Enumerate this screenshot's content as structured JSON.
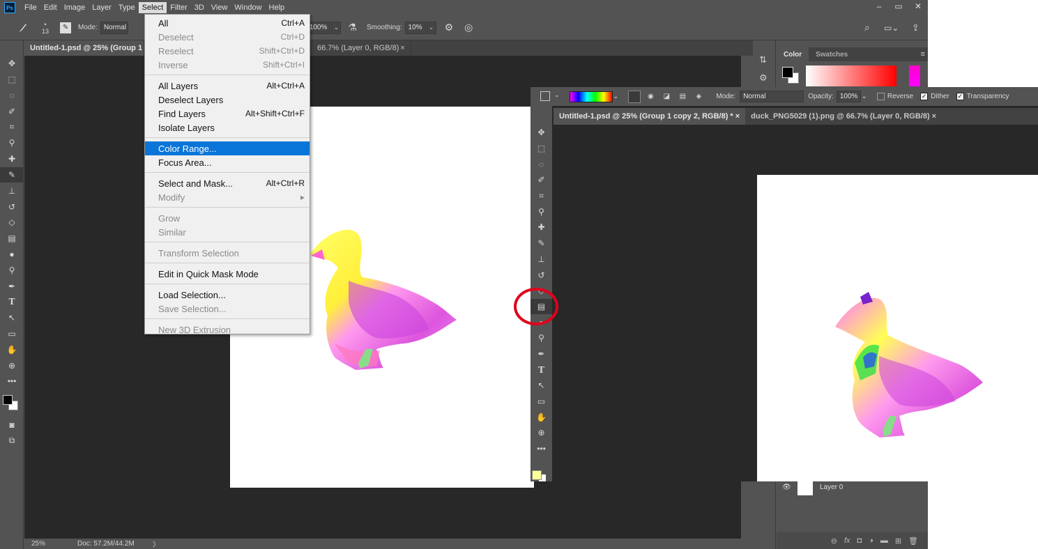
{
  "app": {
    "logo": "Ps"
  },
  "menubar": [
    "File",
    "Edit",
    "Image",
    "Layer",
    "Type",
    "Select",
    "Filter",
    "3D",
    "View",
    "Window",
    "Help"
  ],
  "window_controls": [
    "–",
    "▭",
    "✕"
  ],
  "options": {
    "brush_size": "13",
    "mode_label": "Mode:",
    "mode_value": "Normal",
    "flow_label": "w:",
    "flow_value": "100%",
    "smoothing_label": "Smoothing:",
    "smoothing_value": "10%"
  },
  "doc_tabs": [
    {
      "label": "Untitled-1.psd @ 25% (Group 1 c"
    },
    {
      "label": "66.7% (Layer 0, RGB/8)"
    },
    {
      "close": "×"
    }
  ],
  "select_menu": [
    {
      "label": "All",
      "shortcut": "Ctrl+A",
      "disabled": false
    },
    {
      "label": "Deselect",
      "shortcut": "Ctrl+D",
      "disabled": true
    },
    {
      "label": "Reselect",
      "shortcut": "Shift+Ctrl+D",
      "disabled": true
    },
    {
      "label": "Inverse",
      "shortcut": "Shift+Ctrl+I",
      "disabled": true
    },
    {
      "sep": true
    },
    {
      "label": "All Layers",
      "shortcut": "Alt+Ctrl+A",
      "disabled": false
    },
    {
      "label": "Deselect Layers",
      "shortcut": "",
      "disabled": false
    },
    {
      "label": "Find Layers",
      "shortcut": "Alt+Shift+Ctrl+F",
      "disabled": false
    },
    {
      "label": "Isolate Layers",
      "shortcut": "",
      "disabled": false
    },
    {
      "sep": true
    },
    {
      "label": "Color Range...",
      "shortcut": "",
      "disabled": false,
      "highlighted": true
    },
    {
      "label": "Focus Area...",
      "shortcut": "",
      "disabled": false
    },
    {
      "sep": true
    },
    {
      "label": "Select and Mask...",
      "shortcut": "Alt+Ctrl+R",
      "disabled": false
    },
    {
      "label": "Modify",
      "shortcut": "▸",
      "disabled": true
    },
    {
      "sep": true
    },
    {
      "label": "Grow",
      "shortcut": "",
      "disabled": true
    },
    {
      "label": "Similar",
      "shortcut": "",
      "disabled": true
    },
    {
      "sep": true
    },
    {
      "label": "Transform Selection",
      "shortcut": "",
      "disabled": true
    },
    {
      "sep": true
    },
    {
      "label": "Edit in Quick Mask Mode",
      "shortcut": "",
      "disabled": false
    },
    {
      "sep": true
    },
    {
      "label": "Load Selection...",
      "shortcut": "",
      "disabled": false
    },
    {
      "label": "Save Selection...",
      "shortcut": "",
      "disabled": true
    },
    {
      "sep": true
    },
    {
      "label": "New 3D Extrusion",
      "shortcut": "",
      "disabled": true
    }
  ],
  "status": {
    "zoom": "25%",
    "doc": "Doc: 57.2M/44.2M",
    "arrow": "〉"
  },
  "panels": {
    "tabs": [
      "Color",
      "Swatches"
    ],
    "layer_name": "Layer 0"
  },
  "overlay": {
    "mode_label": "Mode:",
    "mode_value": "Normal",
    "opacity_label": "Opacity:",
    "opacity_value": "100%",
    "reverse_label": "Reverse",
    "dither_label": "Dither",
    "transparency_label": "Transparency",
    "tabs": [
      {
        "label": "Untitled-1.psd @ 25% (Group 1 copy 2, RGB/8) *",
        "close": "×"
      },
      {
        "label": "duck_PNG5029 (1).png @ 66.7% (Layer 0, RGB/8)",
        "close": "×"
      }
    ]
  },
  "colors": {
    "highlight": "#0a75d8",
    "annotation": "#e0001c",
    "fg_swatch": "#ffff99"
  }
}
